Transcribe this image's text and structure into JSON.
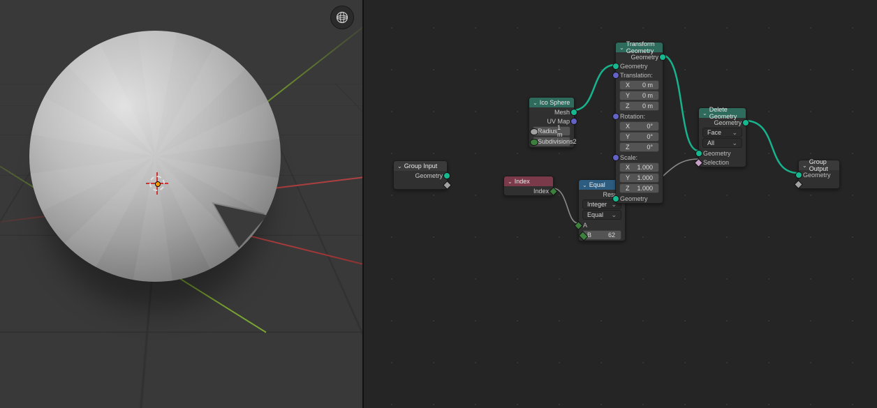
{
  "viewport": {
    "shading_button": "wireframe-sphere-icon"
  },
  "nodes": {
    "group_input": {
      "title": "Group Input",
      "out_geometry": "Geometry"
    },
    "ico": {
      "title": "Ico Sphere",
      "out_mesh": "Mesh",
      "out_uv": "UV Map",
      "radius_label": "Radius",
      "radius_value": "1 m",
      "subdiv_label": "Subdivisions",
      "subdiv_value": "2"
    },
    "index": {
      "title": "Index",
      "out_index": "Index"
    },
    "equal": {
      "title": "Equal",
      "out_result": "Result",
      "dtype": "Integer",
      "mode": "Equal",
      "a_label": "A",
      "b_label": "B",
      "b_value": "62"
    },
    "transform": {
      "title": "Transform Geometry",
      "out_geometry": "Geometry",
      "in_geometry": "Geometry",
      "translation": "Translation:",
      "rotation": "Rotation:",
      "scale": "Scale:",
      "x": "X",
      "y": "Y",
      "z": "Z",
      "t_val": "0 m",
      "r_val": "0°",
      "s_val": "1.000",
      "in_geom2": "Geometry"
    },
    "delete": {
      "title": "Delete Geometry",
      "out_geometry": "Geometry",
      "domain": "Face",
      "mode": "All",
      "in_geometry": "Geometry",
      "in_selection": "Selection"
    },
    "group_output": {
      "title": "Group Output",
      "in_geometry": "Geometry"
    }
  }
}
